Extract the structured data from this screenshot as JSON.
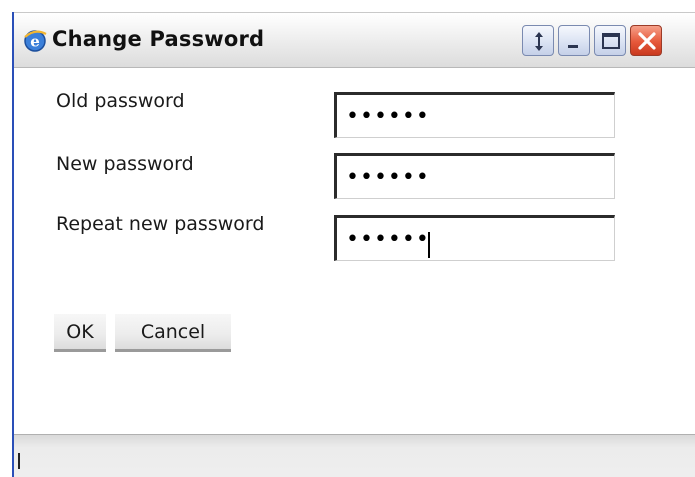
{
  "window": {
    "title": "Change Password",
    "app_icon": "ie-globe-icon"
  },
  "title_buttons": {
    "resize_icon": "resize-arrows-icon",
    "minimize_icon": "minimize-icon",
    "maximize_icon": "maximize-icon",
    "close_icon": "close-icon"
  },
  "form": {
    "old_password": {
      "label": "Old password",
      "value": "••••••"
    },
    "new_password": {
      "label": "New password",
      "value": "••••••"
    },
    "repeat_new_password": {
      "label": "Repeat new password",
      "value": "••••••"
    }
  },
  "buttons": {
    "ok_label": "OK",
    "cancel_label": "Cancel"
  },
  "colors": {
    "window_left_border": "#2a4fb8",
    "close_button": "#e6583a",
    "title_button": "#dbe3f3"
  }
}
